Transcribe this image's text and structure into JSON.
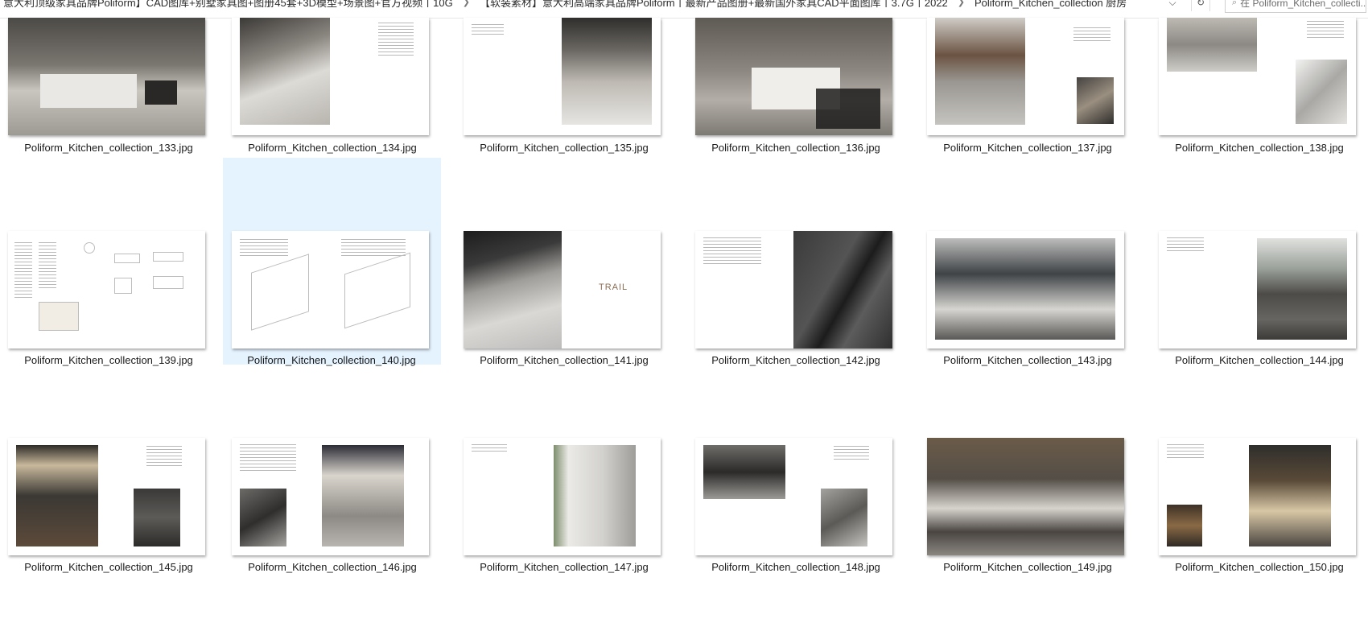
{
  "breadcrumb": {
    "items": [
      "意大利顶级家具品牌Poliform】CAD图库+别墅家具图+图册45套+3D模型+场景图+官方视频丨10G",
      "【软装素材】意大利高端家具品牌Poliform丨最新产品图册+最新国外家具CAD平面图库丨3.7G丨2022",
      "Poliform_Kitchen_collection 厨房"
    ]
  },
  "search": {
    "placeholder": "在 Poliform_Kitchen_collecti..."
  },
  "files": [
    {
      "name": "Poliform_Kitchen_collection_133.jpg"
    },
    {
      "name": "Poliform_Kitchen_collection_134.jpg"
    },
    {
      "name": "Poliform_Kitchen_collection_135.jpg"
    },
    {
      "name": "Poliform_Kitchen_collection_136.jpg"
    },
    {
      "name": "Poliform_Kitchen_collection_137.jpg"
    },
    {
      "name": "Poliform_Kitchen_collection_138.jpg"
    },
    {
      "name": "Poliform_Kitchen_collection_139.jpg"
    },
    {
      "name": "Poliform_Kitchen_collection_140.jpg",
      "selected": true
    },
    {
      "name": "Poliform_Kitchen_collection_141.jpg",
      "page_word": "TRAIL"
    },
    {
      "name": "Poliform_Kitchen_collection_142.jpg"
    },
    {
      "name": "Poliform_Kitchen_collection_143.jpg"
    },
    {
      "name": "Poliform_Kitchen_collection_144.jpg"
    },
    {
      "name": "Poliform_Kitchen_collection_145.jpg"
    },
    {
      "name": "Poliform_Kitchen_collection_146.jpg"
    },
    {
      "name": "Poliform_Kitchen_collection_147.jpg"
    },
    {
      "name": "Poliform_Kitchen_collection_148.jpg"
    },
    {
      "name": "Poliform_Kitchen_collection_149.jpg"
    },
    {
      "name": "Poliform_Kitchen_collection_150.jpg"
    }
  ],
  "colors": {
    "selection": "#e5f3ff",
    "accent": "#0078d4"
  },
  "icons": {
    "breadcrumb_separator": "chevron-right-icon",
    "dropdown": "chevron-down-icon",
    "refresh": "refresh-icon",
    "search": "search-icon"
  }
}
